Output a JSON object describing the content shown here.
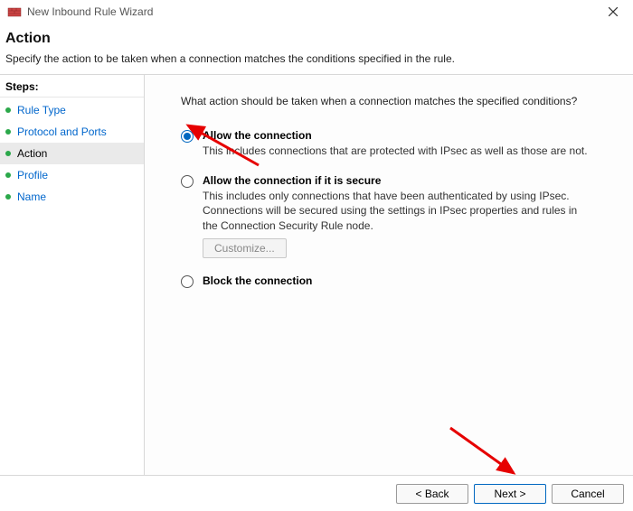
{
  "window": {
    "title": "New Inbound Rule Wizard"
  },
  "header": {
    "title": "Action",
    "subtitle": "Specify the action to be taken when a connection matches the conditions specified in the rule."
  },
  "steps": {
    "heading": "Steps:",
    "items": [
      {
        "label": "Rule Type",
        "current": false
      },
      {
        "label": "Protocol and Ports",
        "current": false
      },
      {
        "label": "Action",
        "current": true
      },
      {
        "label": "Profile",
        "current": false
      },
      {
        "label": "Name",
        "current": false
      }
    ]
  },
  "content": {
    "question": "What action should be taken when a connection matches the specified conditions?",
    "options": [
      {
        "title": "Allow the connection",
        "desc": "This includes connections that are protected with IPsec as well as those are not.",
        "selected": true
      },
      {
        "title": "Allow the connection if it is secure",
        "desc": "This includes only connections that have been authenticated by using IPsec.  Connections will be secured using the settings in IPsec properties and rules in the Connection Security Rule node.",
        "selected": false,
        "customize_label": "Customize..."
      },
      {
        "title": "Block the connection",
        "desc": "",
        "selected": false
      }
    ]
  },
  "footer": {
    "back": "< Back",
    "next": "Next >",
    "cancel": "Cancel"
  }
}
